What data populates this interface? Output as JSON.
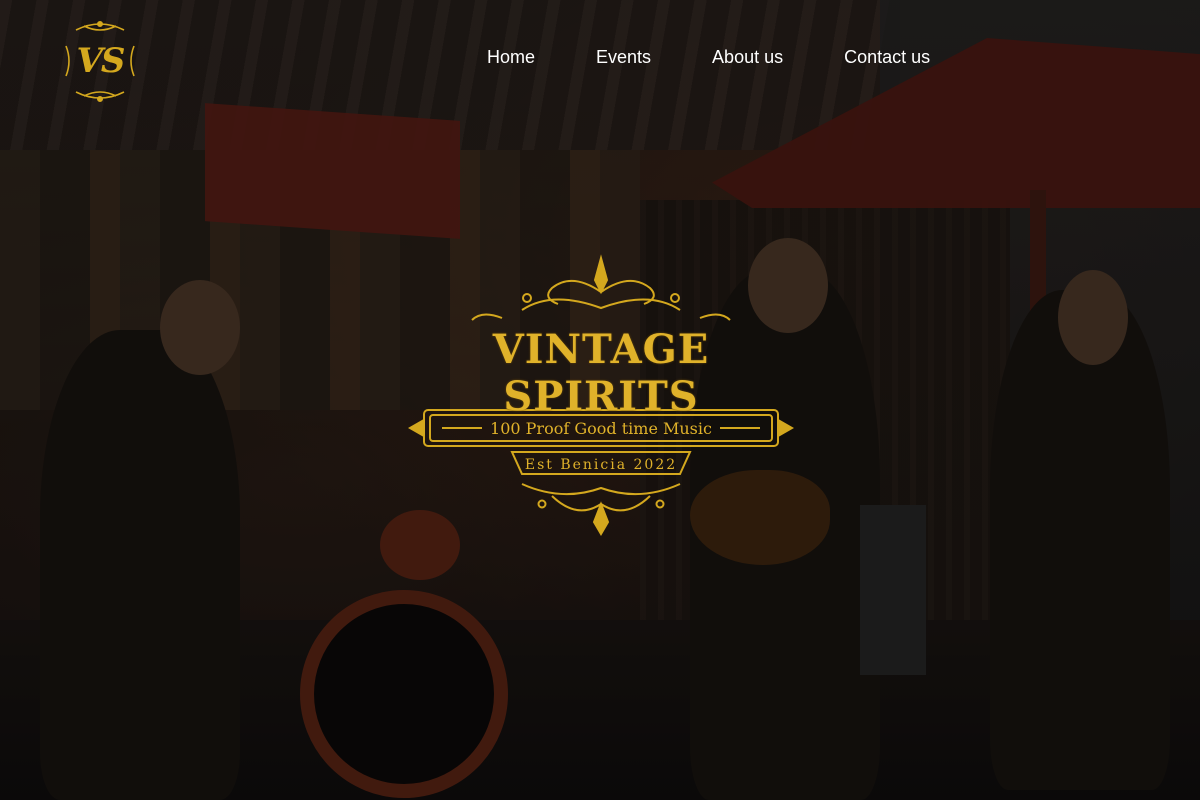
{
  "logo": {
    "text": "VS"
  },
  "nav": {
    "items": [
      {
        "label": "Home"
      },
      {
        "label": "Events"
      },
      {
        "label": "About us"
      },
      {
        "label": "Contact us"
      }
    ]
  },
  "hero": {
    "title": "VINTAGE SPIRITS",
    "tagline": "100 Proof Good time Music",
    "established": "Est Benicia 2022"
  },
  "colors": {
    "accent_gold": "#e0b22a",
    "nav_text": "#ffffff"
  }
}
